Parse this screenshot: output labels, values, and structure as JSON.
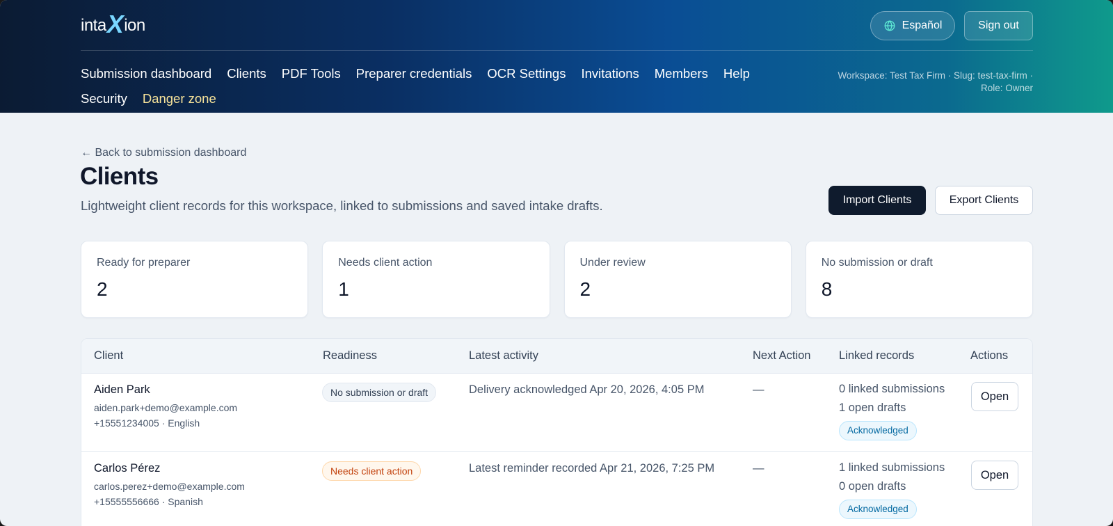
{
  "header": {
    "logo": {
      "pre": "inta",
      "x": "X",
      "post": "ion"
    },
    "language_button": "Español",
    "sign_out_button": "Sign out",
    "nav": [
      "Submission dashboard",
      "Clients",
      "PDF Tools",
      "Preparer credentials",
      "OCR Settings",
      "Invitations",
      "Members",
      "Help",
      "Security",
      "Danger zone"
    ],
    "workspace_line1": "Workspace: Test Tax Firm · Slug: test-tax-firm ·",
    "workspace_line2": "Role: Owner"
  },
  "page": {
    "back_link": "← Back to submission dashboard",
    "title": "Clients",
    "subtitle": "Lightweight client records for this workspace, linked to submissions and saved intake drafts.",
    "import_button": "Import Clients",
    "export_button": "Export Clients"
  },
  "stats": [
    {
      "label": "Ready for preparer",
      "value": "2"
    },
    {
      "label": "Needs client action",
      "value": "1"
    },
    {
      "label": "Under review",
      "value": "2"
    },
    {
      "label": "No submission or draft",
      "value": "8"
    }
  ],
  "table": {
    "columns": [
      "Client",
      "Readiness",
      "Latest activity",
      "Next Action",
      "Linked records",
      "Actions"
    ],
    "rows": [
      {
        "name": "Aiden Park",
        "email": "aiden.park+demo@example.com",
        "phone_lang": "+15551234005 · English",
        "readiness": "No submission or draft",
        "activity": "Delivery acknowledged Apr 20, 2026, 4:05 PM",
        "next_action": "—",
        "linked_submissions": "0 linked submissions",
        "open_drafts": "1 open drafts",
        "status": "Acknowledged",
        "action": "Open"
      },
      {
        "name": "Carlos Pérez",
        "email": "carlos.perez+demo@example.com",
        "phone_lang": "+15555556666 · Spanish",
        "readiness": "Needs client action",
        "activity": "Latest reminder recorded Apr 21, 2026, 7:25 PM",
        "next_action": "—",
        "linked_submissions": "1 linked submissions",
        "open_drafts": "0 open drafts",
        "status": "Acknowledged",
        "action": "Open"
      }
    ]
  }
}
